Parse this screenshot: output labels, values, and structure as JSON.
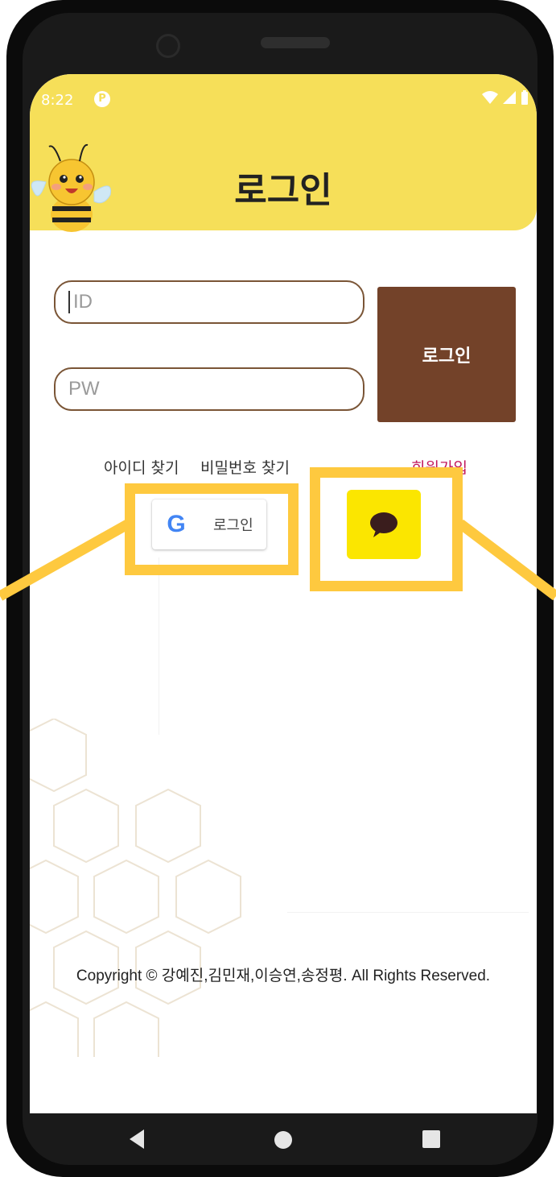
{
  "status_bar": {
    "time": "8:22",
    "notification_icon": "P"
  },
  "header": {
    "title": "로그인"
  },
  "form": {
    "id_placeholder": "ID",
    "pw_placeholder": "PW",
    "login_button": "로그인"
  },
  "links": {
    "find_id": "아이디 찾기",
    "find_pw": "비밀번호 찾기",
    "signup": "회원가입"
  },
  "social": {
    "google_label": "로그인",
    "google_letter": "G"
  },
  "footer": {
    "copyright": "Copyright © 강예진,김민재,이승연,송정평. All Rights Reserved."
  },
  "colors": {
    "header_yellow": "#f6df59",
    "login_brown": "#734229",
    "kakao_yellow": "#fbe600",
    "highlight": "#fec93f",
    "signup_pink": "#c2185b"
  }
}
